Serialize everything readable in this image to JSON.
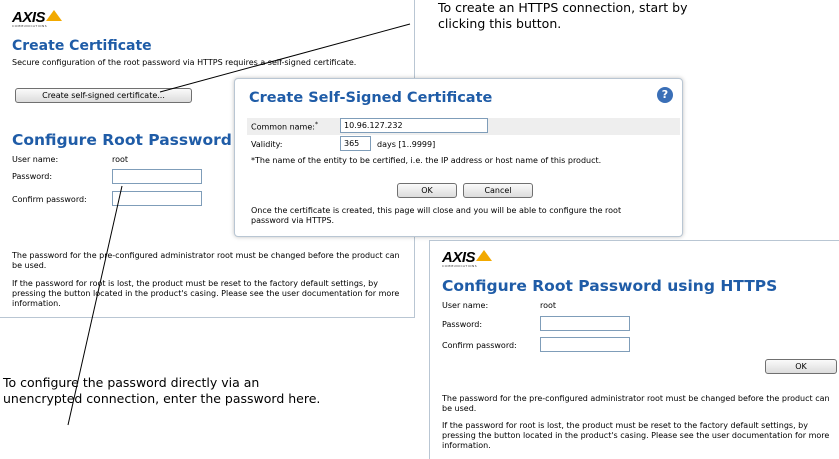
{
  "callouts": {
    "https": "To create an HTTPS connection, start by clicking this button.",
    "direct": "To configure the password directly via an unencrypted connection, enter the password here."
  },
  "left_panel": {
    "logo": "AXIS",
    "logo_sub": "COMMUNICATIONS",
    "cert_title": "Create Certificate",
    "cert_desc": "Secure configuration of the root password via HTTPS requires a self-signed certificate.",
    "cert_button": "Create self-signed certificate...",
    "root_title": "Configure Root Password",
    "user_label": "User name:",
    "user_value": "root",
    "password_label": "Password:",
    "confirm_label": "Confirm password:",
    "note1": "The password for the pre-configured administrator root must be changed before the product can be used.",
    "note2": "If the password for root is lost, the product must be reset to the factory default settings, by pressing the button located in the product's casing. Please see the user documentation for more information."
  },
  "cert_dialog": {
    "title": "Create Self-Signed Certificate",
    "help_icon": "help-icon",
    "common_name_label": "Common name:",
    "required_mark": "*",
    "common_name_value": "10.96.127.232",
    "validity_label": "Validity:",
    "validity_value": "365",
    "validity_hint": "days [1..9999]",
    "footnote": "*The name of the entity to be certified, i.e. the IP address or host name of this product.",
    "ok": "OK",
    "cancel": "Cancel",
    "info": "Once the certificate is created, this page will close and you will be able to configure the root password via HTTPS."
  },
  "https_panel": {
    "logo": "AXIS",
    "logo_sub": "COMMUNICATIONS",
    "title": "Configure Root Password using HTTPS",
    "user_label": "User name:",
    "user_value": "root",
    "password_label": "Password:",
    "confirm_label": "Confirm password:",
    "ok": "OK",
    "note1": "The password for the pre-configured administrator root must be changed before the product can be used.",
    "note2": "If the password for root is lost, the product must be reset to the factory default settings, by pressing the button located in the product's casing. Please see the user documentation for more information."
  },
  "colors": {
    "title_blue": "#1f5ca7",
    "logo_yellow": "#f2a900",
    "panel_border": "#b9c6d3"
  }
}
